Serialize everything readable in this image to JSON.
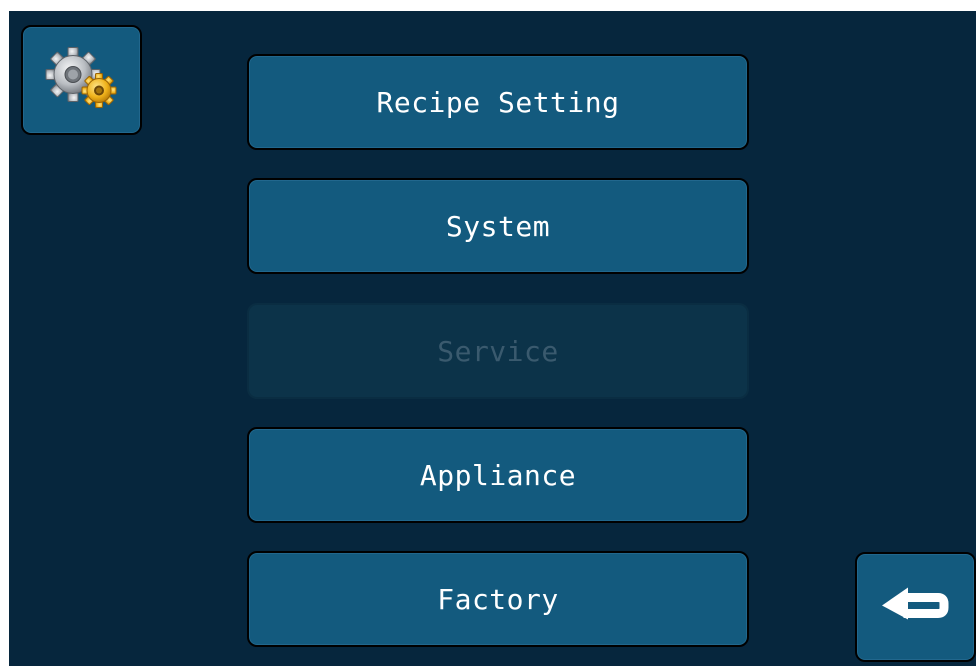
{
  "menu": {
    "items": [
      {
        "label": "Recipe Setting",
        "enabled": true
      },
      {
        "label": "System",
        "enabled": true
      },
      {
        "label": "Service",
        "enabled": false
      },
      {
        "label": "Appliance",
        "enabled": true
      },
      {
        "label": "Factory",
        "enabled": true
      }
    ]
  },
  "icons": {
    "settings": "gears-icon",
    "back": "return-arrow-icon"
  },
  "colors": {
    "background": "#06263d",
    "button": "#135a7e",
    "button_disabled": "#0c3349",
    "text": "#ffffff",
    "text_disabled": "#3a5a6e",
    "gear_silver": "#c9ccd0",
    "gear_gold": "#f2b51c"
  }
}
